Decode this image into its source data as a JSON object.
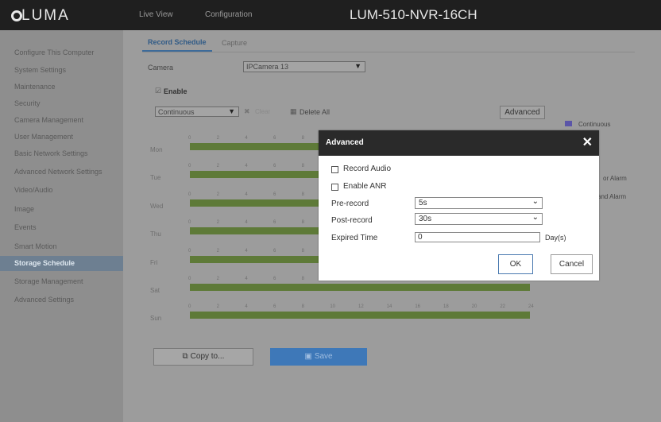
{
  "header": {
    "logo": "LUMA",
    "nav_live": "Live View",
    "nav_config": "Configuration",
    "device": "LUM-510-NVR-16CH"
  },
  "sidebar": {
    "items": [
      {
        "label": "Configure This Computer"
      },
      {
        "label": "System Settings"
      },
      {
        "label": "Maintenance"
      },
      {
        "label": "Security"
      },
      {
        "label": "Camera Management"
      },
      {
        "label": "User Management"
      },
      {
        "label": "Basic Network Settings"
      },
      {
        "label": "Advanced Network Settings"
      },
      {
        "label": "Video/Audio"
      },
      {
        "label": "Image"
      },
      {
        "label": "Events"
      },
      {
        "label": "Smart Motion"
      },
      {
        "label": "Storage Schedule",
        "active": true
      },
      {
        "label": "Storage Management"
      },
      {
        "label": "Advanced Settings"
      }
    ]
  },
  "tabs": {
    "record_schedule": "Record Schedule",
    "capture": "Capture"
  },
  "form": {
    "camera_label": "Camera",
    "camera_value": "IPCamera 13",
    "enable_label": "Enable",
    "mode_value": "Continuous",
    "clear_label": "Clear",
    "delete_all": "Delete All",
    "advanced_button": "Advanced",
    "legend_continuous": "Continuous",
    "legend_or_alarm": "or Alarm",
    "legend_and_alarm": "and Alarm"
  },
  "schedule": {
    "days": [
      "Mon",
      "Tue",
      "Wed",
      "Thu",
      "Fri",
      "Sat",
      "Sun"
    ],
    "ticks": [
      "0",
      "2",
      "4",
      "6",
      "8",
      "10",
      "12",
      "14",
      "16",
      "18",
      "20",
      "22",
      "24"
    ]
  },
  "bottom": {
    "copy_to": "Copy to...",
    "save": "Save"
  },
  "modal": {
    "title": "Advanced",
    "record_audio": "Record Audio",
    "enable_anr": "Enable ANR",
    "prerecord_label": "Pre-record",
    "prerecord_value": "5s",
    "postrecord_label": "Post-record",
    "postrecord_value": "30s",
    "expired_label": "Expired Time",
    "expired_value": "0",
    "expired_unit": "Day(s)",
    "ok": "OK",
    "cancel": "Cancel"
  },
  "colors": {
    "topbar": "#1f1f1f",
    "bar_green": "#5e7a38",
    "legend_continuous": "#5b55a8",
    "save_button": "#3e78b8",
    "modal_header": "#2a2a2a"
  }
}
